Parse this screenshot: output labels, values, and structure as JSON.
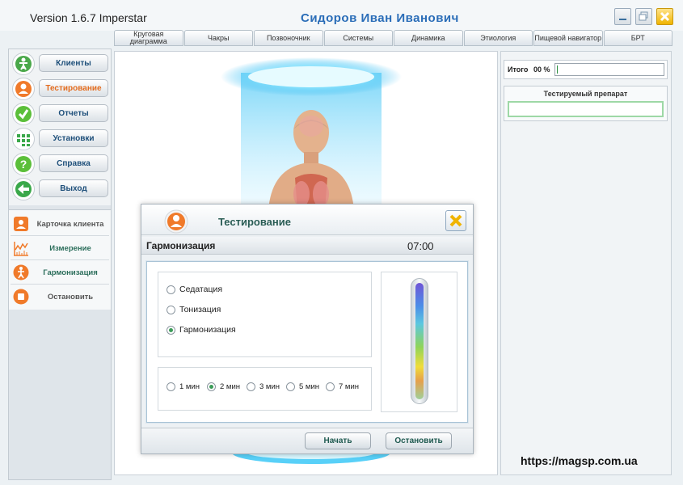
{
  "window": {
    "app_title": "Version 1.6.7 Imperstar",
    "user_name": "Сидоров  Иван  Иванович"
  },
  "tabs": [
    {
      "label": "Круговая диаграмма"
    },
    {
      "label": "Чакры"
    },
    {
      "label": "Позвоночник"
    },
    {
      "label": "Системы"
    },
    {
      "label": "Динамика"
    },
    {
      "label": "Этиология"
    },
    {
      "label": "Пищевой навигатор"
    },
    {
      "label": "БРТ"
    }
  ],
  "sidebar": {
    "nav": [
      {
        "label": "Клиенты",
        "icon": "person-icon",
        "color": "#4aa84a"
      },
      {
        "label": "Тестирование",
        "icon": "user-icon",
        "color": "#f07a2a",
        "active": true
      },
      {
        "label": "Отчеты",
        "icon": "checkmark-icon",
        "color": "#5bbf3a"
      },
      {
        "label": "Установки",
        "icon": "grid-icon",
        "color": "#3aa84a"
      },
      {
        "label": "Справка",
        "icon": "question-icon",
        "color": "#5bbf3a"
      },
      {
        "label": "Выход",
        "icon": "exit-arrow-icon",
        "color": "#3aa84a"
      }
    ],
    "actions": [
      {
        "label": "Карточка клиента",
        "icon": "client-card-icon"
      },
      {
        "label": "Измерение",
        "icon": "measurement-chart-icon"
      },
      {
        "label": "Гармонизация",
        "icon": "harmonization-icon"
      },
      {
        "label": "Остановить",
        "icon": "stop-icon"
      }
    ]
  },
  "right_panel": {
    "total_label": "Итого",
    "total_value": "00  %",
    "total_progress": 0,
    "preparation_label": "Тестируемый препарат",
    "preparation_value": ""
  },
  "website": "https://magsp.com.ua",
  "dialog": {
    "title": "Тестирование",
    "mode_title": "Гармонизация",
    "timer": "07:00",
    "modes": [
      {
        "label": "Седатация",
        "selected": false
      },
      {
        "label": "Тонизация",
        "selected": false
      },
      {
        "label": "Гармонизация",
        "selected": true
      }
    ],
    "durations": [
      {
        "label": "1 мин",
        "selected": false
      },
      {
        "label": "2 мин",
        "selected": true
      },
      {
        "label": "3 мин",
        "selected": false
      },
      {
        "label": "5 мин",
        "selected": false
      },
      {
        "label": "7 мин",
        "selected": false
      }
    ],
    "start_label": "Начать",
    "stop_label": "Остановить"
  },
  "colors": {
    "accent_green": "#2a5d55",
    "accent_orange": "#e36b1d",
    "title_blue": "#2a6db8",
    "close_yellow": "#f0b400"
  }
}
